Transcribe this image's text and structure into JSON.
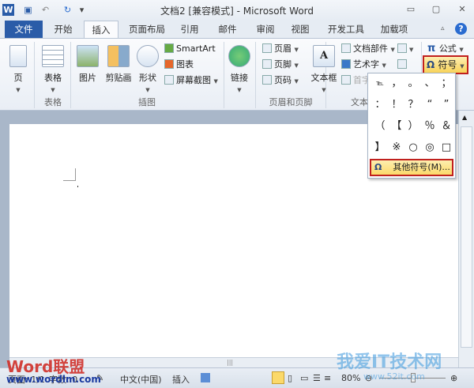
{
  "window": {
    "title": "文档2 [兼容模式] - Microsoft Word"
  },
  "tabs": [
    "文件",
    "开始",
    "插入",
    "页面布局",
    "引用",
    "邮件",
    "审阅",
    "视图",
    "开发工具",
    "加载项"
  ],
  "ribbon": {
    "page": "页",
    "table": "表格",
    "picture": "图片",
    "clipart": "剪贴画",
    "shapes": "形状",
    "smartart": "SmartArt",
    "chart": "图表",
    "screenshot": "屏幕截图",
    "link": "链接",
    "header": "页眉",
    "footer": "页脚",
    "pagenum": "页码",
    "textbox": "文本框",
    "quickparts": "文档部件",
    "wordart": "艺术字",
    "dropcap": "首字",
    "equation": "公式",
    "symbol": "符号",
    "groups": {
      "table": "表格",
      "illustrations": "插图",
      "headerfooter": "页眉和页脚",
      "text": "文本"
    }
  },
  "symbol_menu": {
    "symbols": [
      "℡",
      "，",
      "。",
      "、",
      "；",
      "：",
      "！",
      "？",
      "“",
      "”",
      "（",
      "【",
      "）",
      "％",
      "＆",
      "】",
      "※",
      "○",
      "◎",
      "□"
    ],
    "more": "其他符号(M)..."
  },
  "status": {
    "page": "页面: 1/1",
    "words": "字数: 0",
    "language": "中文(中国)",
    "mode": "插入",
    "zoom": "80%"
  },
  "watermarks": {
    "left": "Word联盟",
    "left_url": "www.wordlm.com",
    "right": "我爱IT技术网",
    "right_url": "www.52it.com"
  }
}
